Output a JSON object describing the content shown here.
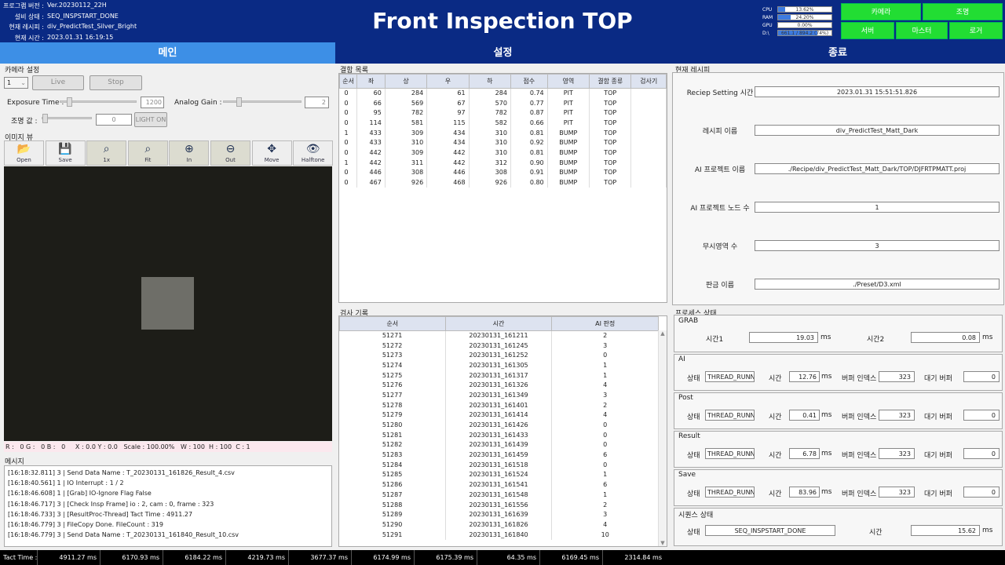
{
  "header": {
    "info": [
      {
        "k": "프로그램 버전 :",
        "v": "Ver.20230112_22H"
      },
      {
        "k": "설비 상태 :",
        "v": "SEQ_INSPSTART_DONE"
      },
      {
        "k": "현재 레시피 :",
        "v": "div_PredictTest_Silver_Bright"
      },
      {
        "k": "현재 시간 :",
        "v": "2023.01.31  16:19:15"
      }
    ],
    "title": "Front Inspection TOP",
    "resources": [
      {
        "name": "CPU",
        "text": "13.62%",
        "level": 0.136
      },
      {
        "name": "RAM",
        "text": "24.20%",
        "level": 0.242
      },
      {
        "name": "GPU",
        "text": "0.00%",
        "level": 0
      },
      {
        "name": "D:\\",
        "text": "661.1 / 894.2 (74%)",
        "level": 0.74
      }
    ],
    "buttons": [
      "카메라",
      "조명",
      "서버",
      "마스터",
      "로거"
    ],
    "accent": "#22dd33"
  },
  "tabs": [
    "메인",
    "설정",
    "종료"
  ],
  "camera": {
    "group": "카메라 설정",
    "camera_select": "1",
    "live": "Live",
    "stop": "Stop",
    "exposure_label": "Exposure Time :",
    "exposure_value": "1200",
    "gain_label": "Analog Gain :",
    "gain_value": "2",
    "light_label": "조명 값 :",
    "light_value": "0",
    "light_on": "LIGHT ON"
  },
  "image_view": {
    "group": "이미지 뷰",
    "tools": [
      {
        "label": "Open",
        "icon": "folder-icon",
        "glyph": "📂"
      },
      {
        "label": "Save",
        "icon": "save-icon",
        "glyph": "💾"
      },
      {
        "label": "1x",
        "icon": "zoom-1x-icon",
        "glyph": "⌕"
      },
      {
        "label": "Fit",
        "icon": "zoom-fit-icon",
        "glyph": "⌕"
      },
      {
        "label": "In",
        "icon": "zoom-in-icon",
        "glyph": "⊕"
      },
      {
        "label": "Out",
        "icon": "zoom-out-icon",
        "glyph": "⊖"
      },
      {
        "label": "Move",
        "icon": "move-icon",
        "glyph": "✥"
      },
      {
        "label": "Halftone",
        "icon": "eye-icon",
        "glyph": "👁"
      }
    ],
    "status": "R :   0 G :   0 B :   0     X : 0.0 Y : 0.0   Scale : 100.00%   W : 100  H : 100  C : 1"
  },
  "messages": {
    "group": "메시지",
    "lines": [
      "[16:18:32.811] 3 | Send Data Name : T_20230131_161826_Result_4.csv",
      "[16:18:40.561] 1 | IO Interrupt : 1 / 2",
      "[16:18:46.608] 1 | [Grab] IO-Ignore Flag False",
      "[16:18:46.717] 3 | [Check Insp Frame] io : 2, cam : 0, frame : 323",
      "[16:18:46.733] 3 | [ResultProc-Thread] Tact Time : 4911.27",
      "[16:18:46.779] 3 | FileCopy Done. FileCount : 319",
      "[16:18:46.779] 3 | Send Data Name : T_20230131_161840_Result_10.csv"
    ]
  },
  "defects": {
    "group": "결함 목록",
    "headers": [
      "순서",
      "좌",
      "상",
      "우",
      "하",
      "점수",
      "영역",
      "결함 종류",
      "검사기"
    ],
    "rows": [
      [
        "0",
        "60",
        "284",
        "61",
        "284",
        "0.74",
        "PIT",
        "TOP",
        ""
      ],
      [
        "0",
        "66",
        "569",
        "67",
        "570",
        "0.77",
        "PIT",
        "TOP",
        ""
      ],
      [
        "0",
        "95",
        "782",
        "97",
        "782",
        "0.87",
        "PIT",
        "TOP",
        ""
      ],
      [
        "0",
        "114",
        "581",
        "115",
        "582",
        "0.66",
        "PIT",
        "TOP",
        ""
      ],
      [
        "1",
        "433",
        "309",
        "434",
        "310",
        "0.81",
        "BUMP",
        "TOP",
        ""
      ],
      [
        "0",
        "433",
        "310",
        "434",
        "310",
        "0.92",
        "BUMP",
        "TOP",
        ""
      ],
      [
        "0",
        "442",
        "309",
        "442",
        "310",
        "0.81",
        "BUMP",
        "TOP",
        ""
      ],
      [
        "1",
        "442",
        "311",
        "442",
        "312",
        "0.90",
        "BUMP",
        "TOP",
        ""
      ],
      [
        "0",
        "446",
        "308",
        "446",
        "308",
        "0.91",
        "BUMP",
        "TOP",
        ""
      ],
      [
        "0",
        "467",
        "926",
        "468",
        "926",
        "0.80",
        "BUMP",
        "TOP",
        ""
      ]
    ]
  },
  "history": {
    "group": "검사 기록",
    "headers": [
      "순서",
      "시간",
      "AI 판정"
    ],
    "rows": [
      [
        "51271",
        "20230131_161211",
        "2"
      ],
      [
        "51272",
        "20230131_161245",
        "3"
      ],
      [
        "51273",
        "20230131_161252",
        "0"
      ],
      [
        "51274",
        "20230131_161305",
        "1"
      ],
      [
        "51275",
        "20230131_161317",
        "1"
      ],
      [
        "51276",
        "20230131_161326",
        "4"
      ],
      [
        "51277",
        "20230131_161349",
        "3"
      ],
      [
        "51278",
        "20230131_161401",
        "2"
      ],
      [
        "51279",
        "20230131_161414",
        "4"
      ],
      [
        "51280",
        "20230131_161426",
        "0"
      ],
      [
        "51281",
        "20230131_161433",
        "0"
      ],
      [
        "51282",
        "20230131_161439",
        "0"
      ],
      [
        "51283",
        "20230131_161459",
        "6"
      ],
      [
        "51284",
        "20230131_161518",
        "0"
      ],
      [
        "51285",
        "20230131_161524",
        "1"
      ],
      [
        "51286",
        "20230131_161541",
        "6"
      ],
      [
        "51287",
        "20230131_161548",
        "1"
      ],
      [
        "51288",
        "20230131_161556",
        "2"
      ],
      [
        "51289",
        "20230131_161639",
        "3"
      ],
      [
        "51290",
        "20230131_161826",
        "4"
      ],
      [
        "51291",
        "20230131_161840",
        "10"
      ]
    ]
  },
  "recipe": {
    "group": "현재 레시피",
    "items": [
      {
        "label": "Reciep Setting 시간",
        "value": "2023.01.31  15:51:51.826"
      },
      {
        "label": "레시피 이름",
        "value": "div_PredictTest_Matt_Dark"
      },
      {
        "label": "AI 프로젝트 이름",
        "value": "./Recipe/div_PredictTest_Matt_Dark/TOP/DJFRTPMATT.proj"
      },
      {
        "label": "AI 프로젝트 노드 수",
        "value": "1"
      },
      {
        "label": "무시영역 수",
        "value": "3"
      },
      {
        "label": "판금 이름",
        "value": "./Preset/D3.xml"
      }
    ]
  },
  "process": {
    "group": "프로세스 상태",
    "grab": {
      "name": "GRAB",
      "t1_label": "시간1",
      "t1": "19.03",
      "t2_label": "시간2",
      "t2": "0.08",
      "unit": "ms"
    },
    "labels": {
      "state": "상태",
      "time": "시간",
      "buf": "버퍼 인덱스",
      "wait": "대기 버퍼",
      "unit": "ms"
    },
    "threads": [
      {
        "name": "AI",
        "state": "THREAD_RUNNING",
        "time": "12.76",
        "buf": "323",
        "wait": "0"
      },
      {
        "name": "Post",
        "state": "THREAD_RUNNING",
        "time": "0.41",
        "buf": "323",
        "wait": "0"
      },
      {
        "name": "Result",
        "state": "THREAD_RUNNING",
        "time": "6.78",
        "buf": "323",
        "wait": "0"
      },
      {
        "name": "Save",
        "state": "THREAD_RUNNING",
        "time": "83.96",
        "buf": "323",
        "wait": "0"
      }
    ],
    "seq": {
      "name": "시퀀스 상태",
      "state_label": "상태",
      "state": "SEQ_INSPSTART_DONE",
      "time_label": "시간",
      "time": "15.62",
      "unit": "ms"
    }
  },
  "tact": {
    "label": "Tact Time :",
    "values": [
      "4911.27 ms",
      "6170.93 ms",
      "6184.22 ms",
      "4219.73 ms",
      "3677.37 ms",
      "6174.99 ms",
      "6175.39 ms",
      "64.35 ms",
      "6169.45 ms",
      "2314.84 ms"
    ]
  }
}
